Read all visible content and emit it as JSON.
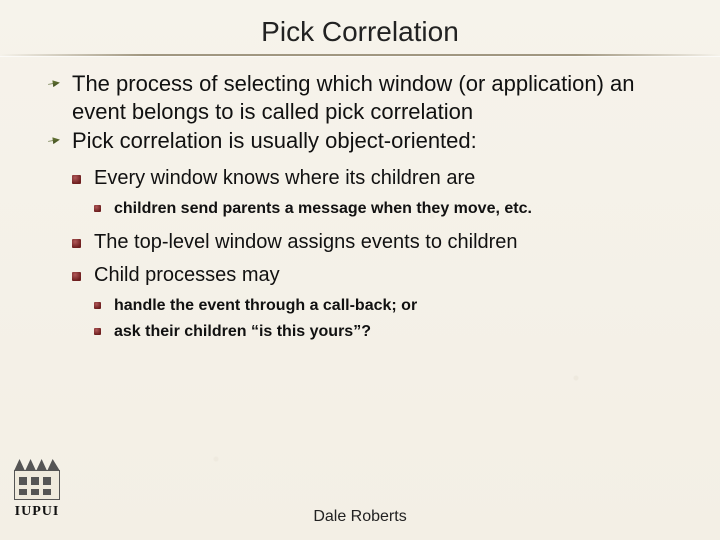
{
  "title": "Pick Correlation",
  "bullets": {
    "l1": [
      "The process of selecting which window (or application) an event belongs to is called pick correlation",
      "Pick correlation is usually object-oriented:"
    ],
    "l2": [
      "Every window knows where its children are",
      "The top-level window assigns events to children",
      "Child processes may"
    ],
    "l3a": [
      "children send parents a message when they move, etc."
    ],
    "l3b": [
      "handle the event through a call-back; or",
      "ask their children “is this yours”?"
    ]
  },
  "footer": {
    "author": "Dale Roberts"
  },
  "logo": {
    "text": "IUPUI"
  }
}
